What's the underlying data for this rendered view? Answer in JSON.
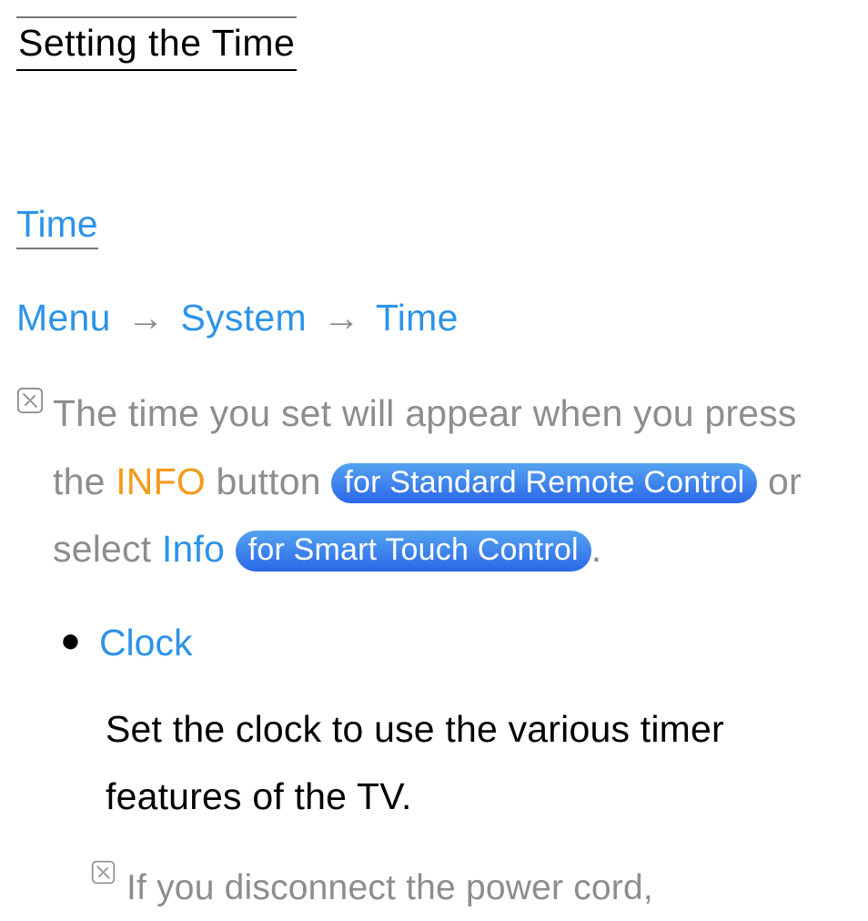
{
  "title": "Setting the Time",
  "section_heading": "Time",
  "breadcrumb": {
    "menu": "Menu",
    "system": "System",
    "time": "Time"
  },
  "note1": {
    "part1": "The time you set will appear when you press the ",
    "info_btn": "INFO",
    "part2": " button ",
    "pill1": "for Standard Remote Control",
    "part3": " or select ",
    "info_sel": "Info",
    "pill2": "for Smart Touch Control",
    "period": "."
  },
  "bullet": {
    "label": "Clock",
    "body": "Set the clock to use the various timer features of the TV."
  },
  "note2": {
    "text": "If you disconnect the power cord,"
  }
}
